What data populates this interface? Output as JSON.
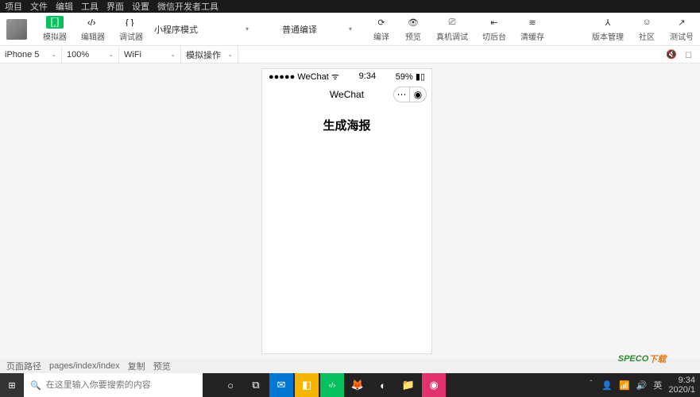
{
  "menu": {
    "items": [
      "项目",
      "文件",
      "编辑",
      "工具",
      "界面",
      "设置",
      "微信开发者工具"
    ]
  },
  "toolbar": {
    "simulator": "模拟器",
    "editor": "编辑器",
    "debugger": "调试器",
    "mode_select": "小程序模式",
    "compile_select": "普通编译",
    "compile": "编译",
    "preview": "预览",
    "remote_debug": "真机调试",
    "cut_back": "切后台",
    "clear_cache": "清缓存",
    "version": "版本管理",
    "community": "社区",
    "test_account": "测试号"
  },
  "subbar": {
    "device": "iPhone 5",
    "zoom": "100%",
    "network": "WiFi",
    "action": "模拟操作"
  },
  "phone": {
    "carrier": "●●●●● WeChat",
    "time": "9:34",
    "battery": "59%",
    "title": "WeChat",
    "heading": "生成海报"
  },
  "status": {
    "label": "页面路径",
    "path": "pages/index/index",
    "copy": "复制",
    "preview": "预览"
  },
  "search": {
    "placeholder": "在这里输入你要搜索的内容"
  },
  "tray": {
    "ime": "英",
    "time": "9:34",
    "date": "2020/1"
  },
  "watermark": {
    "a": "SPECO",
    "b": "下载"
  }
}
